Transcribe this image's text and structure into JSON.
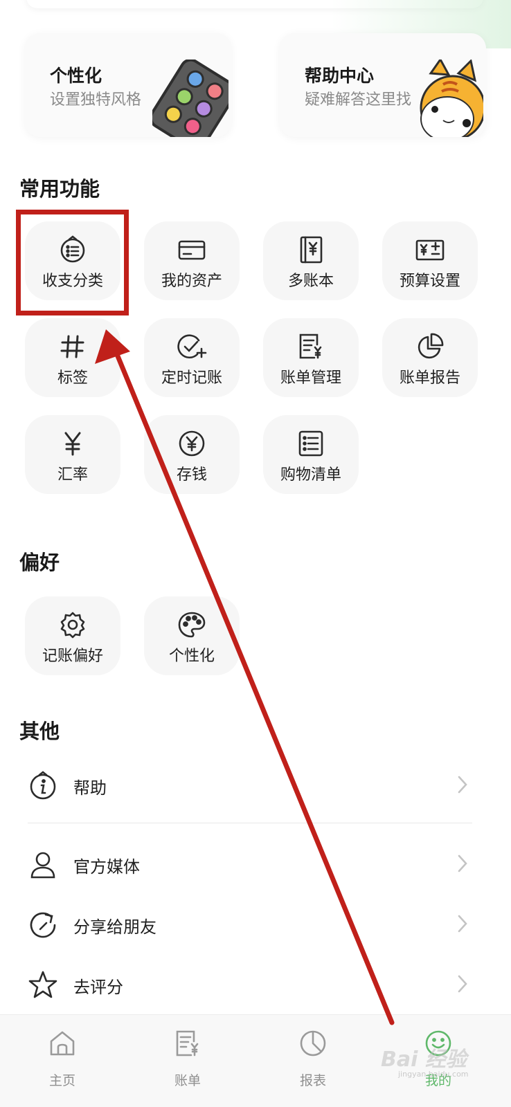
{
  "cards": [
    {
      "title": "个性化",
      "subtitle": "设置独特风格"
    },
    {
      "title": "帮助中心",
      "subtitle": "疑难解答这里找"
    }
  ],
  "sections": {
    "common": {
      "title": "常用功能",
      "tiles": [
        {
          "label": "收支分类",
          "icon": "category-list-icon"
        },
        {
          "label": "我的资产",
          "icon": "card-icon"
        },
        {
          "label": "多账本",
          "icon": "ledger-book-icon"
        },
        {
          "label": "预算设置",
          "icon": "budget-icon"
        },
        {
          "label": "标签",
          "icon": "hashtag-icon"
        },
        {
          "label": "定时记账",
          "icon": "timed-check-icon"
        },
        {
          "label": "账单管理",
          "icon": "bill-manage-icon"
        },
        {
          "label": "账单报告",
          "icon": "pie-report-icon"
        },
        {
          "label": "汇率",
          "icon": "yen-icon"
        },
        {
          "label": "存钱",
          "icon": "coin-yen-icon"
        },
        {
          "label": "购物清单",
          "icon": "checklist-icon"
        }
      ]
    },
    "preferences": {
      "title": "偏好",
      "tiles": [
        {
          "label": "记账偏好",
          "icon": "gear-icon"
        },
        {
          "label": "个性化",
          "icon": "palette-icon"
        }
      ]
    },
    "other": {
      "title": "其他",
      "rows": [
        {
          "label": "帮助",
          "icon": "info-icon"
        },
        {
          "label": "官方媒体",
          "icon": "user-icon"
        },
        {
          "label": "分享给朋友",
          "icon": "share-refresh-icon"
        },
        {
          "label": "去评分",
          "icon": "star-icon"
        }
      ]
    }
  },
  "tabbar": [
    {
      "label": "主页",
      "icon": "home-icon",
      "active": false
    },
    {
      "label": "账单",
      "icon": "bill-icon",
      "active": false
    },
    {
      "label": "报表",
      "icon": "chart-icon",
      "active": false
    },
    {
      "label": "我的",
      "icon": "profile-icon",
      "active": true
    }
  ],
  "colors": {
    "accent": "#5fb86a",
    "annotation": "#c0201a",
    "tile_bg": "#f6f6f6"
  },
  "watermark": {
    "text": "Bai 经验",
    "sub": "jingyan.baidu.com"
  }
}
